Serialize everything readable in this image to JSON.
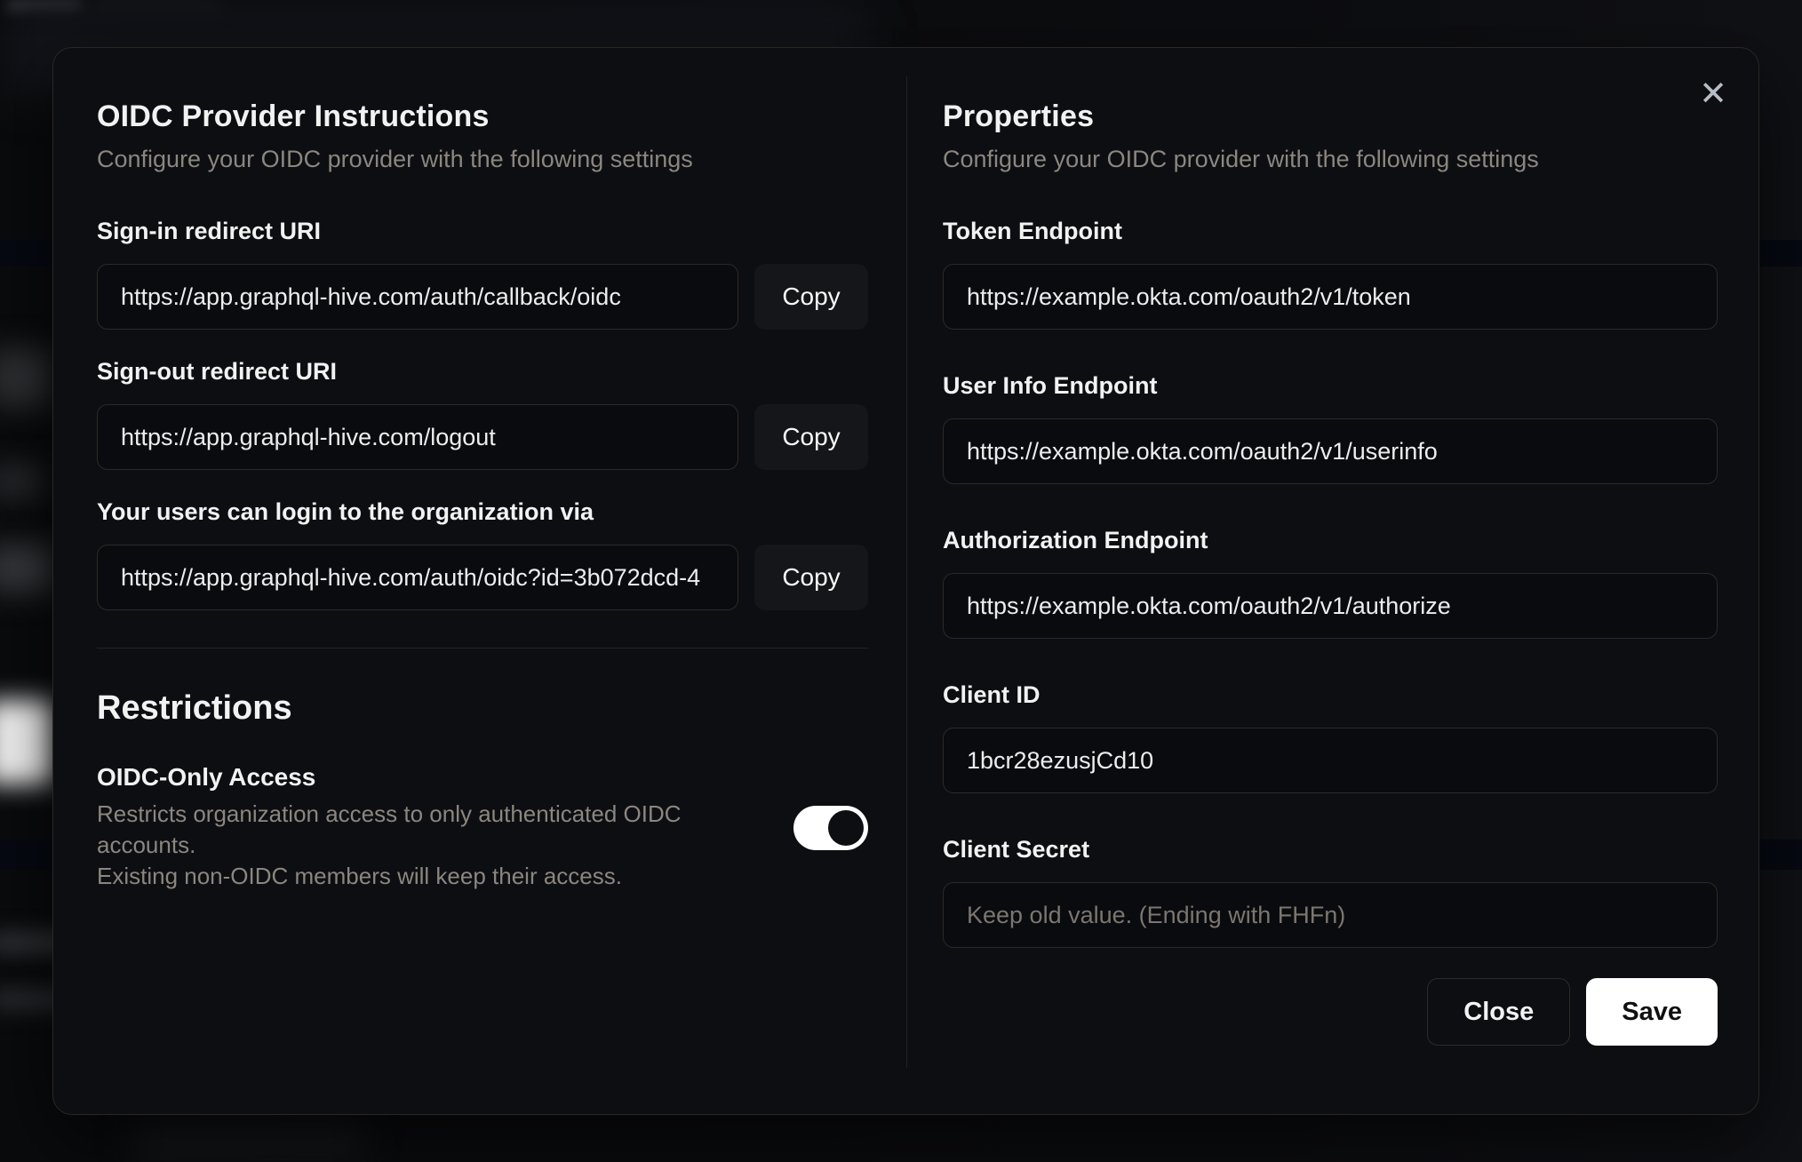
{
  "modal": {
    "close_icon": "✕",
    "left": {
      "title": "OIDC Provider Instructions",
      "subtitle": "Configure your OIDC provider with the following settings",
      "fields": [
        {
          "label": "Sign-in redirect URI",
          "value": "https://app.graphql-hive.com/auth/callback/oidc",
          "copy_label": "Copy"
        },
        {
          "label": "Sign-out redirect URI",
          "value": "https://app.graphql-hive.com/logout",
          "copy_label": "Copy"
        },
        {
          "label": "Your users can login to the organization via",
          "value": "https://app.graphql-hive.com/auth/oidc?id=3b072dcd-4",
          "copy_label": "Copy"
        }
      ],
      "restrictions": {
        "title": "Restrictions",
        "toggle_label": "OIDC-Only Access",
        "toggle_description_line1": "Restricts organization access to only authenticated OIDC accounts.",
        "toggle_description_line2": "Existing non-OIDC members will keep their access.",
        "toggle_state": "on"
      }
    },
    "right": {
      "title": "Properties",
      "subtitle": "Configure your OIDC provider with the following settings",
      "fields": [
        {
          "label": "Token Endpoint",
          "value": "https://example.okta.com/oauth2/v1/token"
        },
        {
          "label": "User Info Endpoint",
          "value": "https://example.okta.com/oauth2/v1/userinfo"
        },
        {
          "label": "Authorization Endpoint",
          "value": "https://example.okta.com/oauth2/v1/authorize"
        },
        {
          "label": "Client ID",
          "value": "1bcr28ezusjCd10"
        },
        {
          "label": "Client Secret",
          "value": "",
          "placeholder": "Keep old value. (Ending with FHFn)"
        }
      ],
      "buttons": {
        "close": "Close",
        "save": "Save"
      }
    }
  },
  "colors": {
    "modal_background": "#0d0e11",
    "save_button_background": "#ffffff",
    "toggle_on": "#ffffff",
    "heading_text": "#f2f2f2",
    "muted_text": "#8b8680"
  }
}
